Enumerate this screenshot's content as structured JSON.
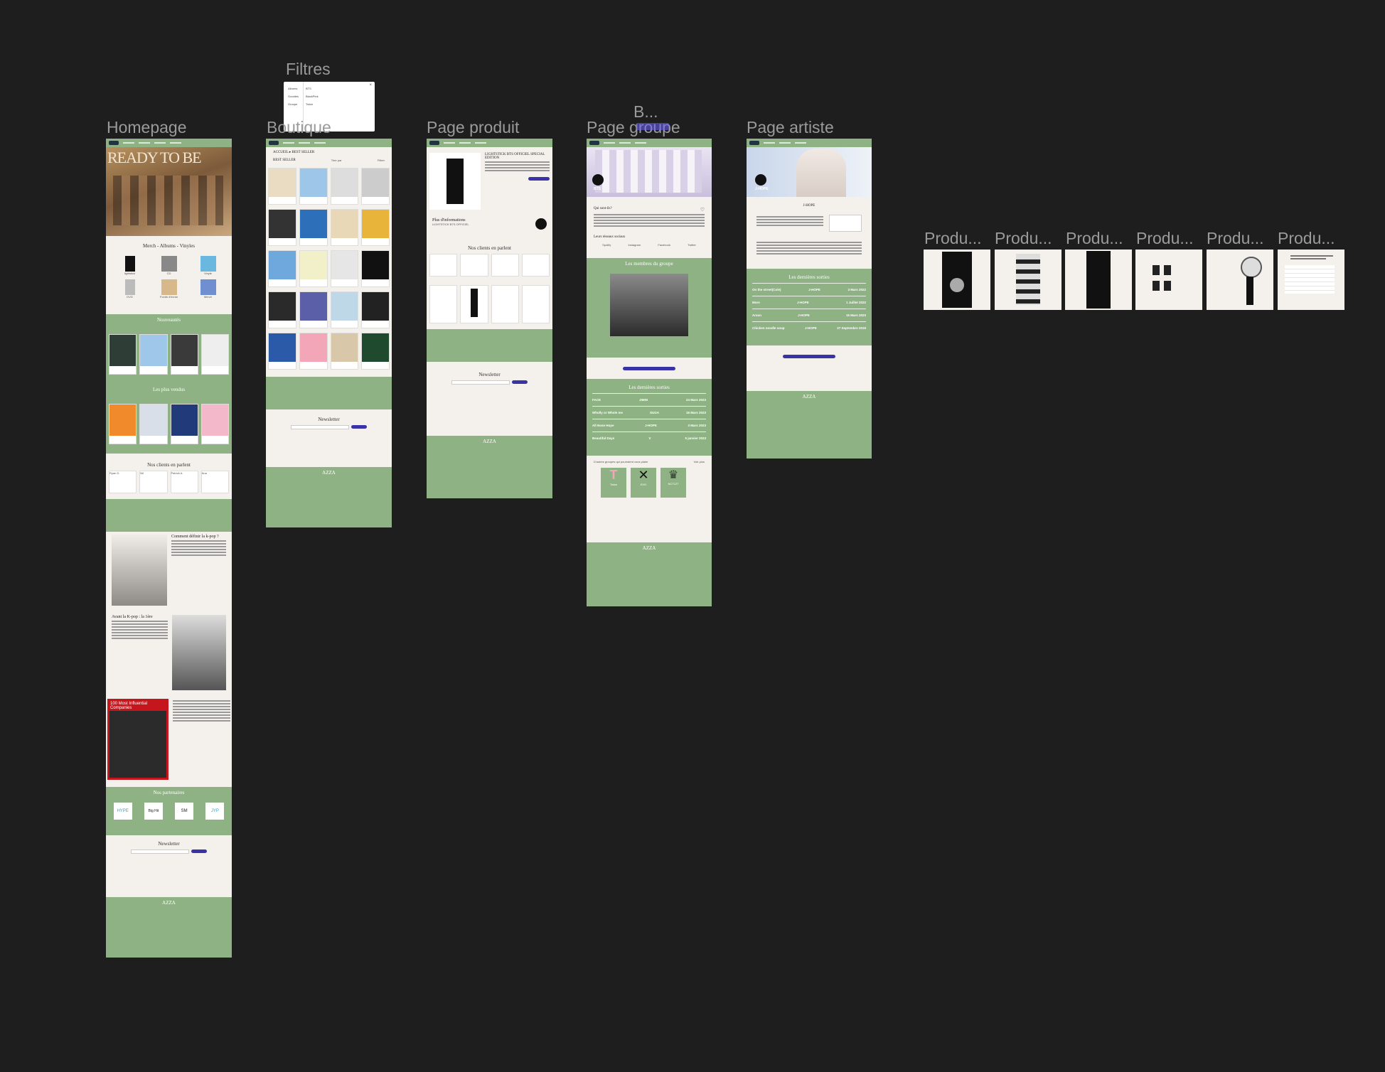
{
  "frames": {
    "filtres": {
      "label": "Filtres",
      "rows": [
        {
          "left": "Albums",
          "right": "BTS"
        },
        {
          "left": "Goodies",
          "right": "BlackPink"
        },
        {
          "left": "Groupe",
          "right": "Twice"
        }
      ]
    },
    "homepage": {
      "label": "Homepage",
      "hero_title": "READY TO BE",
      "section_merch": "Merch - Albums - Vinyles",
      "merch_items": [
        "lightstick",
        "CD",
        "Vinyle",
        "DVD",
        "Fonds d'écran",
        "Merch"
      ],
      "section_new": "Nouveautés",
      "section_best": "Les plus vendus",
      "section_reviews": "Nos clients en parlent",
      "reviewers": [
        "Ryan D.",
        "Nil",
        "Patrick A.",
        "Ana"
      ],
      "article1_title": "Comment définir la k-pop ?",
      "article2_title": "Avant la K-pop : la 1ère",
      "magazine_title": "100 Most Influential Companies",
      "section_partners": "Nos partenaires",
      "partners": [
        "HYPE",
        "Big Hit",
        "SM",
        "JYP"
      ],
      "newsletter": "Newsletter",
      "footer_brand": "AZZA"
    },
    "boutique": {
      "label": "Boutique",
      "breadcrumb": "ACCUEIL ▸ BEST SELLER",
      "heading": "BEST SELLER",
      "sort": "Trier par",
      "filter": "Filtrer",
      "newsletter": "Newsletter",
      "footer_brand": "AZZA"
    },
    "page_produit": {
      "label": "Page produit",
      "product_title": "LIGHTSTICK BTS OFFICIEL SPECIAL EDITION",
      "more_info": "Plus d'informations",
      "more_info_sub": "LIGHTSTICK BTS OFFICIEL",
      "section_reviews": "Nos clients en parlent",
      "newsletter": "Newsletter",
      "footer_brand": "AZZA"
    },
    "page_groupe": {
      "label": "Page groupe",
      "overlay_label": "B...",
      "group_name": "BTS",
      "who": "Qui sont-ils?",
      "socials_title": "Leurs réseaux sociaux",
      "socials": [
        "Spotify",
        "Instagram",
        "Facebook",
        "Twitter"
      ],
      "members_title": "Les membres du groupe",
      "releases_title": "Les dernières sorties",
      "releases": [
        {
          "title": "FACE",
          "artist": "JIMIN",
          "date": "24 Mars 2023"
        },
        {
          "title": "Wholly or Whole me",
          "artist": "SUGA",
          "date": "16 Mars 2023"
        },
        {
          "title": "All Nose Hope",
          "artist": "J-HOPE",
          "date": "3 Mars 2023"
        },
        {
          "title": "Beautiful Days",
          "artist": "V",
          "date": "5 janvier 2023"
        }
      ],
      "other_groups_title": "D'autres groupes qui pourraient vous plaire",
      "see_more": "Voir plus",
      "other_groups": [
        "Twice",
        "EXO",
        "NCT127"
      ],
      "footer_brand": "AZZA"
    },
    "page_artiste": {
      "label": "Page artiste",
      "artist_name": "J-HOPE",
      "artist_heading": "J-HOPE",
      "releases_title": "Les dernières sorties",
      "releases": [
        {
          "title": "On the street(Cole)",
          "artist": "J-HOPE",
          "date": "3 Mars 2022"
        },
        {
          "title": "More",
          "artist": "J-HOPE",
          "date": "1 Juillet 2022"
        },
        {
          "title": "Arson",
          "artist": "J-HOPE",
          "date": "15 Mars 2023"
        },
        {
          "title": "Chicken noodle soup",
          "artist": "J-HOPE",
          "date": "27 Septembre 2019"
        }
      ],
      "footer_brand": "AZZA"
    },
    "products": {
      "labels": [
        "Produ...",
        "Produ...",
        "Produ...",
        "Produ...",
        "Produ...",
        "Produ..."
      ]
    }
  },
  "colors": {
    "canvas": "#1e1e1e",
    "page_bg": "#f4f0ec",
    "brand_green": "#8fb284",
    "button": "#3a33a8",
    "label": "#9a9a9a",
    "selection": "#6b63ff"
  }
}
